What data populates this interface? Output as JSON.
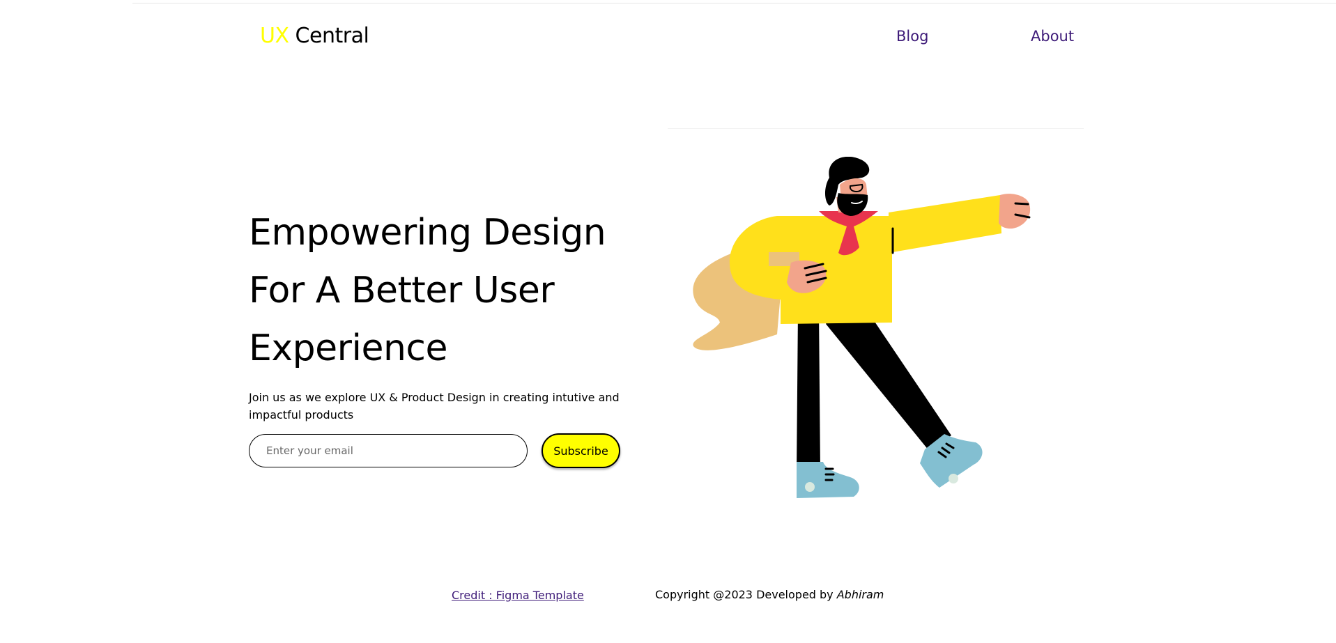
{
  "header": {
    "logo_accent": "UX",
    "logo_rest": " Central",
    "nav": {
      "blog": "Blog",
      "about": "About"
    }
  },
  "hero": {
    "title_lines": [
      "Empowering Design",
      "For A Better User",
      "Experience"
    ],
    "subtitle": "Join us as we explore UX & Product Design in creating intutive and impactful products",
    "email_placeholder": "Enter your email",
    "subscribe_label": "Subscribe"
  },
  "footer": {
    "credit": "Credit : Figma Template",
    "copyright_prefix": "Copyright @2023 Developed by ",
    "author": "Abhiram"
  },
  "colors": {
    "accent_yellow": "#ffff00",
    "link_purple": "#3d1a78",
    "shirt_yellow": "#ffe01b",
    "skin": "#f2a48b",
    "scarf": "#e8344e",
    "shoe_blue": "#83bfd1",
    "back_shape": "#ecc27b"
  },
  "illustration": {
    "name": "walking-bearded-man-illustration"
  }
}
